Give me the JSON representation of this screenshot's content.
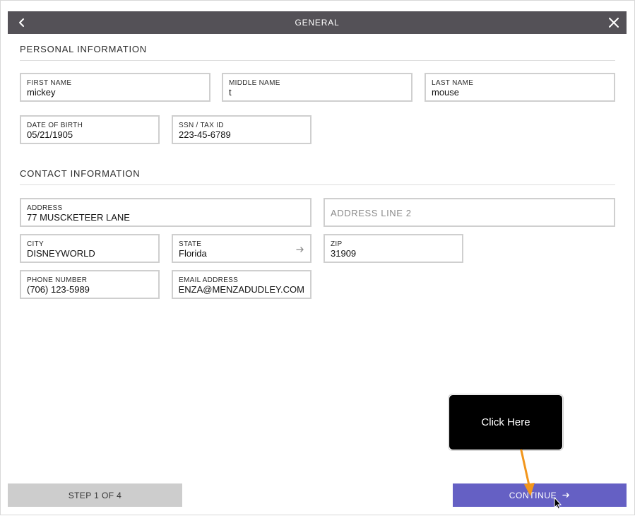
{
  "header": {
    "title": "GENERAL"
  },
  "personal": {
    "title": "PERSONAL INFORMATION",
    "first_name": {
      "label": "FIRST NAME",
      "value": "mickey"
    },
    "middle_name": {
      "label": "MIDDLE NAME",
      "value": "t"
    },
    "last_name": {
      "label": "LAST NAME",
      "value": "mouse"
    },
    "dob": {
      "label": "DATE OF BIRTH",
      "value": "05/21/1905"
    },
    "ssn": {
      "label": "SSN / TAX ID",
      "value": "223-45-6789"
    }
  },
  "contact": {
    "title": "CONTACT INFORMATION",
    "address": {
      "label": "ADDRESS",
      "value": "77 MUSCKETEER LANE"
    },
    "address2": {
      "placeholder": "ADDRESS LINE 2"
    },
    "city": {
      "label": "CITY",
      "value": "DISNEYWORLD"
    },
    "state": {
      "label": "STATE",
      "value": "Florida"
    },
    "zip": {
      "label": "ZIP",
      "value": "31909"
    },
    "phone": {
      "label": "PHONE NUMBER",
      "value": "(706) 123-5989"
    },
    "email": {
      "label": "EMAIL ADDRESS",
      "value": "ENZA@MENZADUDLEY.COM"
    }
  },
  "footer": {
    "step": "STEP 1 OF 4",
    "continue_label": "CONTINUE"
  },
  "callout": {
    "text": "Click Here"
  },
  "colors": {
    "header_bg": "#545157",
    "accent": "#6560c4",
    "step_bg": "#cdcdcd",
    "annotation_arrow": "#f2961c"
  }
}
